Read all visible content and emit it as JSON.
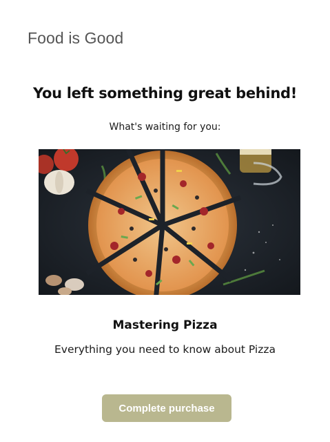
{
  "brand": {
    "name": "Food is Good"
  },
  "email": {
    "headline": "You left something great behind!",
    "subhead": "What's waiting for you:"
  },
  "product": {
    "title": "Mastering Pizza",
    "description": "Everything you need to know about Pizza",
    "image_icon": "pizza-photo"
  },
  "cta": {
    "label": "Complete purchase",
    "color": "#b9b78f"
  }
}
